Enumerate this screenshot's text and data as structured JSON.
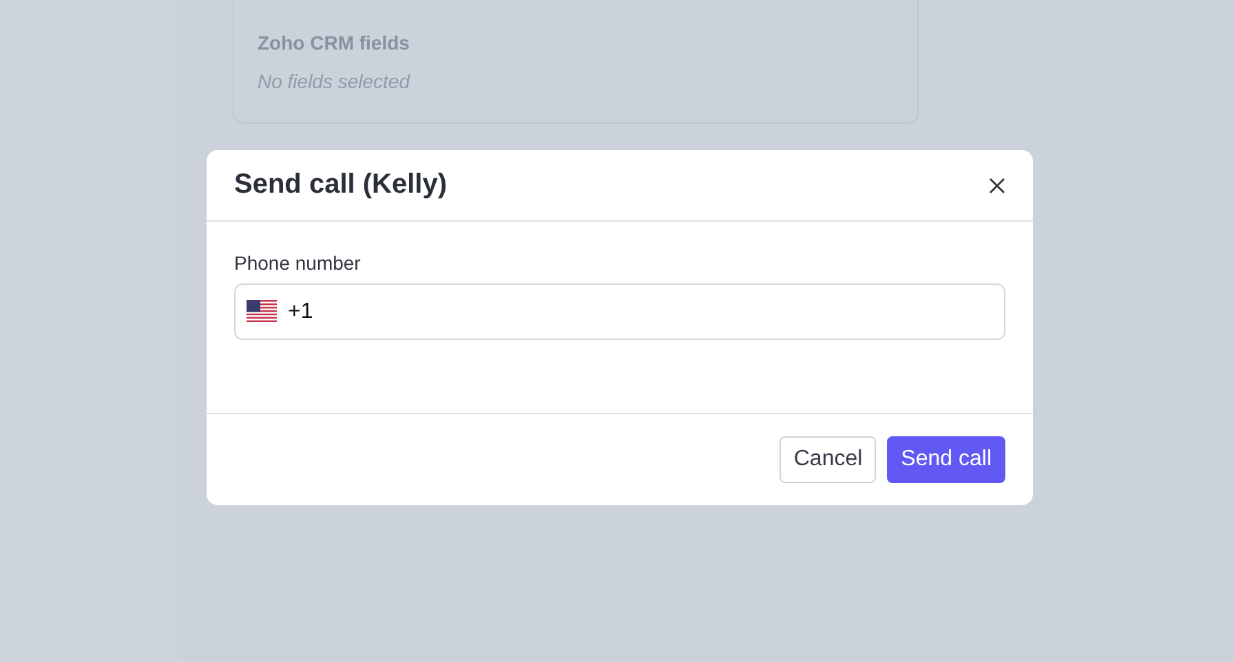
{
  "background_card": {
    "title": "Zoho CRM fields",
    "empty_text": "No fields selected"
  },
  "dialog": {
    "title": "Send call (Kelly)",
    "field": {
      "label": "Phone number",
      "value": "+1"
    },
    "buttons": [
      {
        "label": "Cancel",
        "kind": "secondary"
      },
      {
        "label": "Send call",
        "kind": "primary"
      }
    ]
  }
}
